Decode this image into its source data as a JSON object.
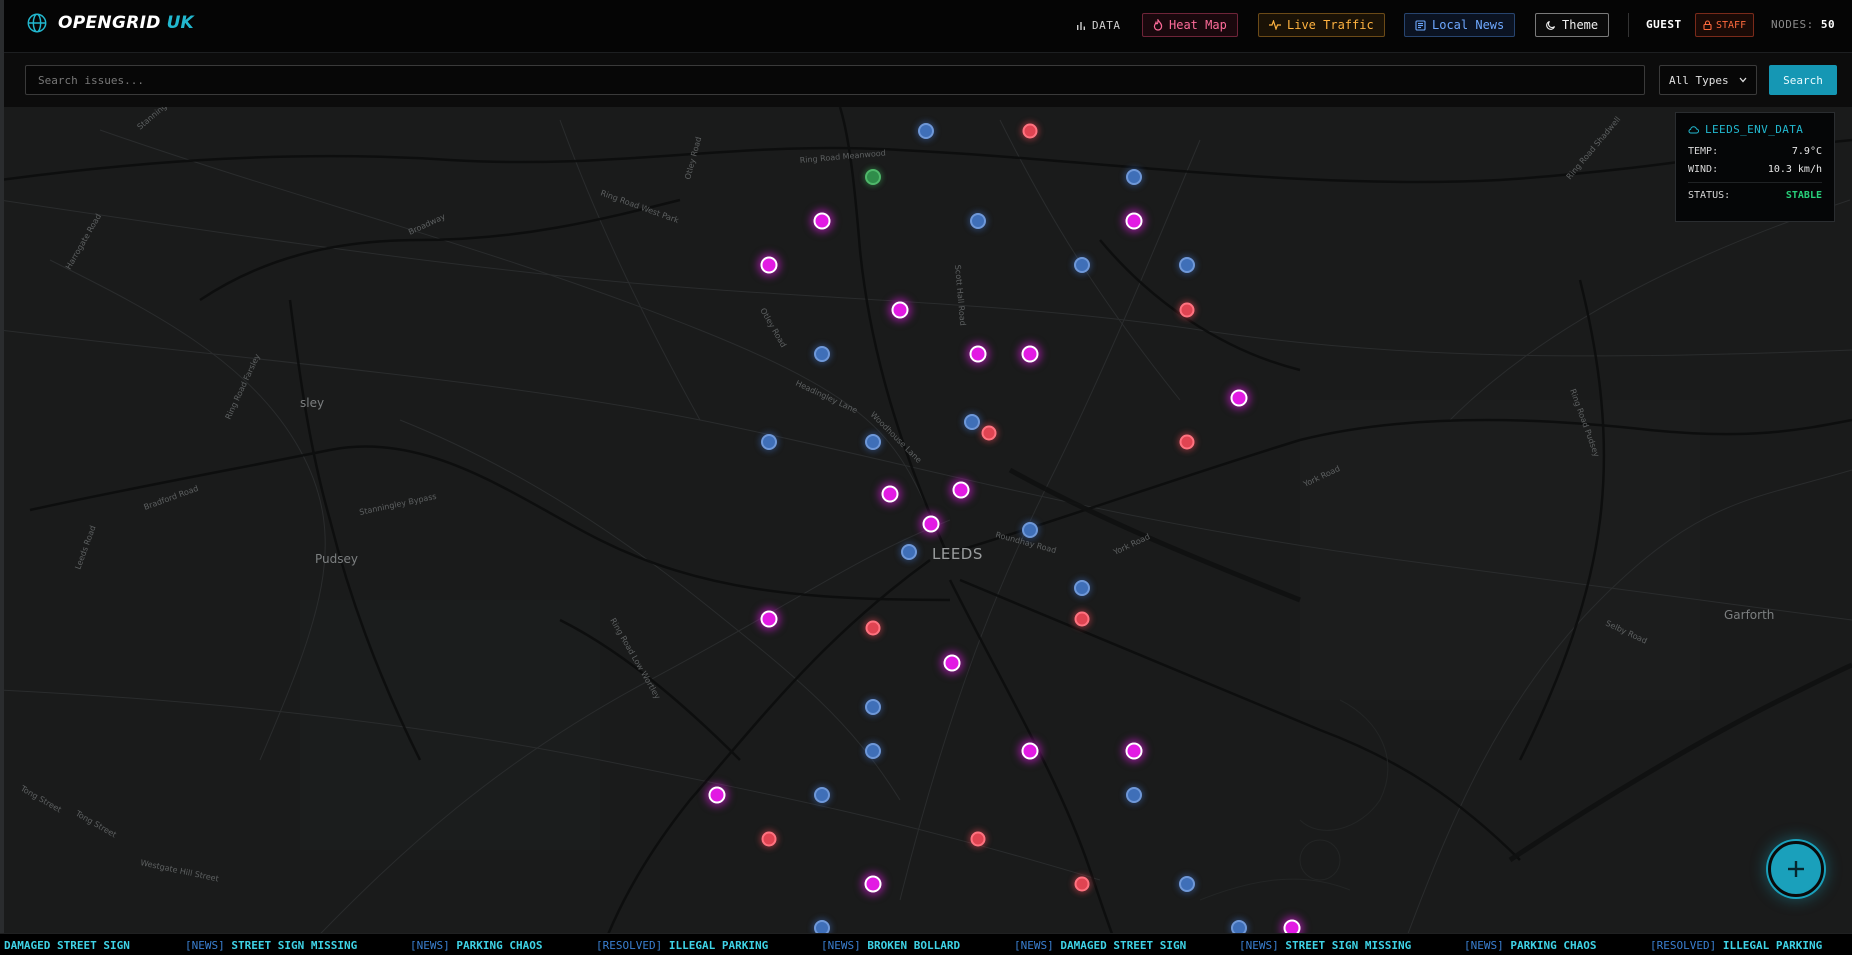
{
  "header": {
    "brand": "OPENGRID",
    "brand_suffix": "UK",
    "nav": {
      "data": "DATA",
      "heat_map": "Heat Map",
      "live_traffic": "Live Traffic",
      "local_news": "Local News",
      "theme": "Theme"
    },
    "user": "GUEST",
    "staff": "STAFF",
    "nodes_label": "NODES:",
    "nodes_count": "50"
  },
  "search": {
    "placeholder": "Search issues...",
    "type_selected": "All Types",
    "button": "Search"
  },
  "map": {
    "places": {
      "leeds": "LEEDS",
      "pudsey": "Pudsey",
      "garforth": "Garforth",
      "sley": "sley"
    },
    "roads": [
      "Ring Road Meanwood",
      "Otley Road",
      "Ring Road West Park",
      "Broadway",
      "Scott Hall Road",
      "Otley Road",
      "Headingley Lane",
      "Woodhouse Lane",
      "Stanningley Bypass",
      "Bradford Road",
      "Ring Road Farsley",
      "Leeds Road",
      "Ring Road Low Wortley",
      "York Road",
      "Selby Road",
      "Tong Street",
      "Westgate Hill Street",
      "Ring Road Shadwell",
      "York Road",
      "Ring Road Pudsey",
      "Roundhay Road",
      "Harrogate Road",
      "Stanningley Road"
    ],
    "markers_total": 50
  },
  "env_panel": {
    "title": "LEEDS_ENV_DATA",
    "temp_label": "TEMP:",
    "temp_value": "7.9°C",
    "wind_label": "WIND:",
    "wind_value": "10.3 km/h",
    "status_label": "STATUS:",
    "status_value": "STABLE"
  },
  "ticker": [
    {
      "tag": "",
      "text": "DAMAGED STREET SIGN"
    },
    {
      "tag": "[NEWS]",
      "text": "STREET SIGN MISSING"
    },
    {
      "tag": "[NEWS]",
      "text": "PARKING CHAOS"
    },
    {
      "tag": "[RESOLVED]",
      "text": "ILLEGAL PARKING"
    },
    {
      "tag": "[NEWS]",
      "text": "BROKEN BOLLARD"
    },
    {
      "tag": "[NEWS]",
      "text": "DAMAGED STREET SIGN"
    },
    {
      "tag": "[NEWS]",
      "text": "STREET SIGN MISSING"
    },
    {
      "tag": "[NEWS]",
      "text": "PARKING CHAOS"
    },
    {
      "tag": "[RESOLVED]",
      "text": "ILLEGAL PARKING"
    }
  ],
  "colors": {
    "accent": "#22b8cf",
    "marker_blue": "#3f6fb8",
    "marker_magenta": "#e21be3",
    "marker_red": "#e04452",
    "marker_green": "#2f8d4a",
    "status_ok": "#28d07a"
  }
}
